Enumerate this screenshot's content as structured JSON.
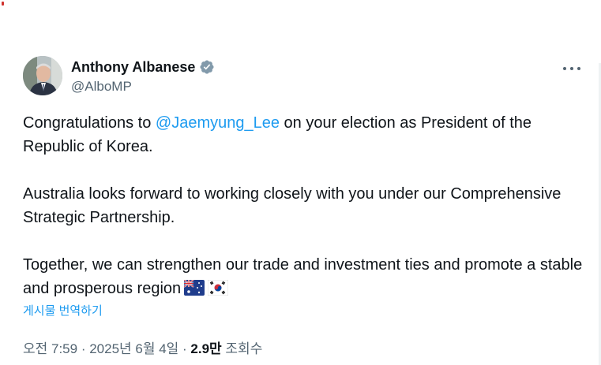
{
  "author": {
    "display_name": "Anthony Albanese",
    "handle": "@AlboMP",
    "verified_icon": "verified-badge-icon",
    "avatar": "profile-photo"
  },
  "tweet": {
    "para1_before": "Congratulations to ",
    "para1_mention": "@Jaemyung_Lee",
    "para1_after": " on your election as President of the Republic of Korea.",
    "para2": "Australia looks forward to working closely with you under our Comprehensive Strategic Partnership.",
    "para3": "Together, we can strengthen our trade and investment ties and promote a stable and prosperous region",
    "emoji": [
      "australia-flag-icon",
      "south-korea-flag-icon"
    ]
  },
  "translate_label": "게시물 번역하기",
  "meta": {
    "time": "오전 7:59",
    "sep1": " · ",
    "date": "2025년 6월 4일",
    "sep2": " · ",
    "views_count": "2.9만",
    "views_label": " 조회수"
  },
  "colors": {
    "link": "#1d9bf0",
    "text": "#0f1419",
    "secondary": "#536471"
  }
}
